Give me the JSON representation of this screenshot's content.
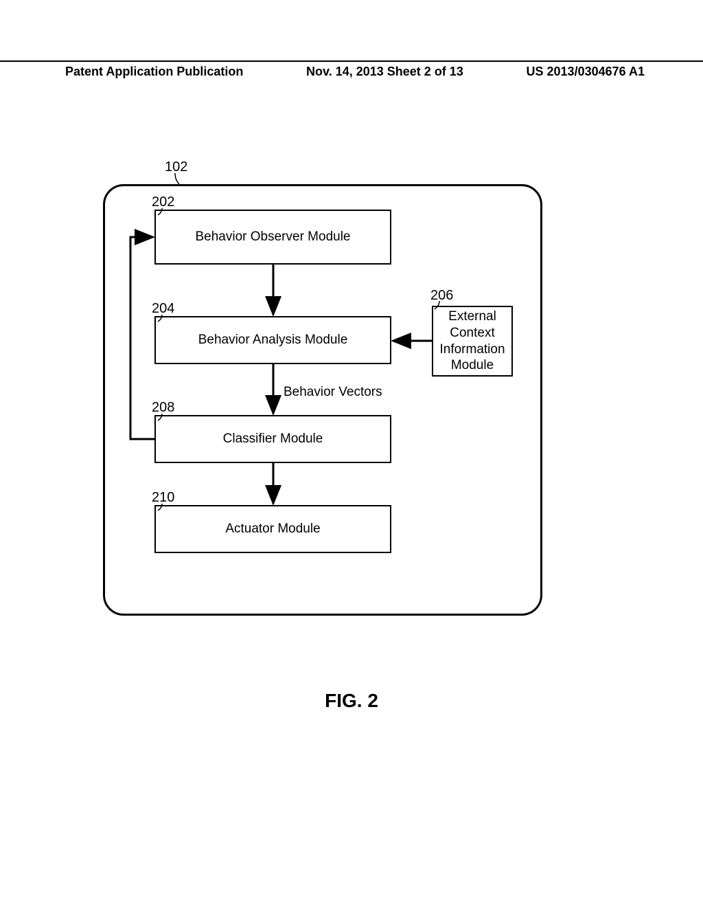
{
  "header": {
    "left": "Patent Application Publication",
    "center": "Nov. 14, 2013  Sheet 2 of 13",
    "right": "US 2013/0304676 A1"
  },
  "refs": {
    "r102": "102",
    "r202": "202",
    "r204": "204",
    "r206": "206",
    "r208": "208",
    "r210": "210"
  },
  "boxes": {
    "observer": "Behavior Observer Module",
    "analysis": "Behavior Analysis Module",
    "external": "External Context Information Module",
    "classifier": "Classifier Module",
    "actuator": "Actuator Module"
  },
  "edges": {
    "behavior_vectors": "Behavior Vectors"
  },
  "figure_caption": "FIG. 2"
}
